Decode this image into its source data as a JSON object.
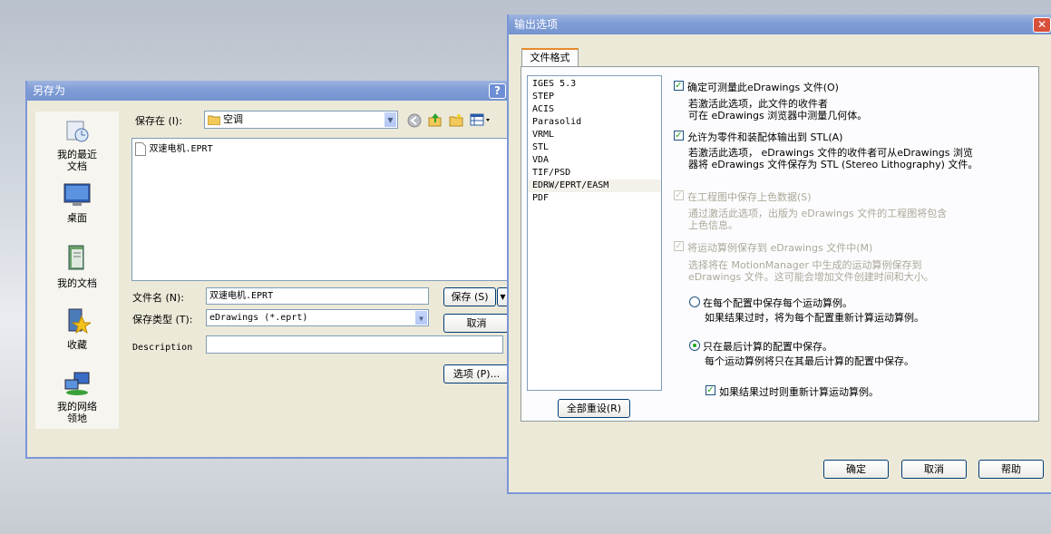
{
  "save_dialog": {
    "title": "另存为",
    "help_btn": "?",
    "places": [
      {
        "label_line1": "我的最近",
        "label_line2": "文档",
        "icon": "recent-docs-icon"
      },
      {
        "label_line1": "桌面",
        "label_line2": "",
        "icon": "desktop-icon"
      },
      {
        "label_line1": "我的文档",
        "label_line2": "",
        "icon": "my-documents-icon"
      },
      {
        "label_line1": "收藏",
        "label_line2": "",
        "icon": "favorites-icon"
      },
      {
        "label_line1": "我的网络",
        "label_line2": "领地",
        "icon": "network-places-icon"
      }
    ],
    "save_in_label": "保存在 (I):",
    "save_in_value": "空调",
    "files": [
      "双速电机.EPRT"
    ],
    "filename_label": "文件名 (N):",
    "filename_value": "双速电机.EPRT",
    "filetype_label": "保存类型 (T):",
    "filetype_value": "eDrawings (*.eprt)",
    "description_label": "Description",
    "description_value": "",
    "save_btn": "保存 (S)",
    "cancel_btn": "取消",
    "options_btn": "选项 (P)..."
  },
  "export_dialog": {
    "title": "输出选项",
    "close_btn": "✕",
    "tab": "文件格式",
    "formats": [
      "IGES 5.3",
      "STEP",
      "ACIS",
      "Parasolid",
      "VRML",
      "STL",
      "VDA",
      "TIF/PSD",
      "EDRW/EPRT/EASM",
      "PDF"
    ],
    "selected_format": "EDRW/EPRT/EASM",
    "reset_btn": "全部重设(R)",
    "opt1": {
      "label": "确定可测量此eDrawings 文件(O)",
      "desc1": "若激活此选项，此文件的收件者",
      "desc2": "可在 eDrawings 浏览器中测量几何体。"
    },
    "opt2": {
      "label": "允许为零件和装配体输出到 STL(A)",
      "desc1": "若激活此选项， eDrawings 文件的收件者可从eDrawings 浏览",
      "desc2": "器将 eDrawings 文件保存为 STL (Stereo Lithography) 文件。"
    },
    "opt3": {
      "label": "在工程图中保存上色数据(S)",
      "desc1": "通过激活此选项，出版为 eDrawings 文件的工程图将包含",
      "desc2": "上色信息。"
    },
    "opt4": {
      "label": "将运动算例保存到 eDrawings 文件中(M)",
      "desc1": "选择将在 MotionManager 中生成的运动算例保存到",
      "desc2": "eDrawings 文件。这可能会增加文件创建时间和大小。"
    },
    "radio1": {
      "label": "在每个配置中保存每个运动算例。",
      "desc": "如果结果过时，将为每个配置重新计算运动算例。"
    },
    "radio2": {
      "label": "只在最后计算的配置中保存。",
      "desc": "每个运动算例将只在其最后计算的配置中保存。"
    },
    "sub_check": "如果结果过时则重新计算运动算例。",
    "ok_btn": "确定",
    "cancel_btn": "取消",
    "help_btn": "帮助"
  }
}
